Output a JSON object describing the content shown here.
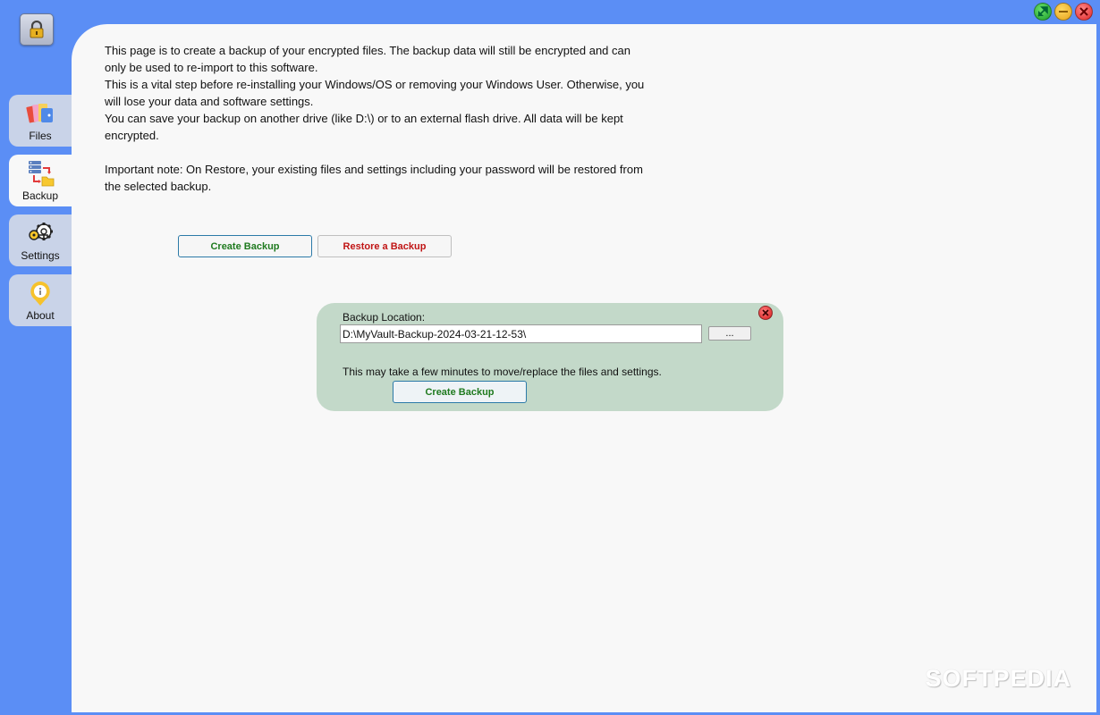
{
  "window": {
    "controls": [
      {
        "icon": "maximize-icon",
        "color": "#1a9e2a"
      },
      {
        "icon": "minimize-icon",
        "color": "#e6a21a"
      },
      {
        "icon": "close-icon",
        "color": "#e02424"
      }
    ]
  },
  "sidebar": {
    "lock_icon": "lock-icon",
    "items": [
      {
        "label": "Files",
        "icon": "files-icon"
      },
      {
        "label": "Backup",
        "icon": "backup-icon",
        "active": true
      },
      {
        "label": "Settings",
        "icon": "settings-icon"
      },
      {
        "label": "About",
        "icon": "info-icon"
      }
    ]
  },
  "main": {
    "intro": [
      "This page is to create a backup of your encrypted files. The backup data will still be encrypted and can only be used to re-import to this software.",
      "This is a vital step before re-installing your Windows/OS or removing your Windows User. Otherwise, you will lose your data and software settings.",
      "You can save your backup on another drive (like D:\\) or to an external flash drive. All data will be kept encrypted.",
      "Important note: On Restore, your existing files and settings including your password will be restored from the selected backup."
    ],
    "create_backup_label": "Create Backup",
    "restore_backup_label": "Restore a Backup"
  },
  "popup": {
    "location_label": "Backup Location:",
    "location_value": "D:\\MyVault-Backup-2024-03-21-12-53\\",
    "browse_label": "...",
    "note": "This may take a few minutes to move/replace the files and settings.",
    "create_label": "Create Backup"
  },
  "watermark": "SOFTPEDIA",
  "colors": {
    "background": "#5b8ef5",
    "panel": "#f8f8f8",
    "popup": "#c3d9c9",
    "create_text": "#1f7a1f",
    "restore_text": "#c01515"
  }
}
